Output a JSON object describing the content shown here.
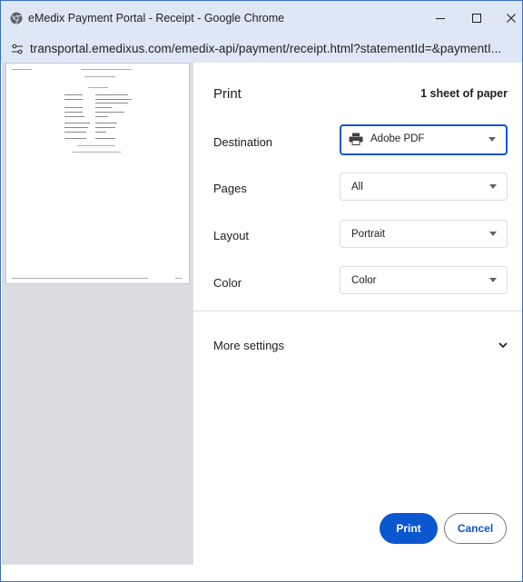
{
  "window": {
    "title": "eMedix Payment Portal - Receipt - Google Chrome",
    "controls": {
      "minimize": "minimize-icon",
      "maximize": "maximize-icon",
      "close": "close-icon"
    }
  },
  "address_bar": {
    "url": "transportal.emedixus.com/emedix-api/payment/receipt.html?statementId=&paymentI..."
  },
  "print_dialog": {
    "title": "Print",
    "sheet_count": "1 sheet of paper",
    "settings": [
      {
        "label": "Destination",
        "value": "Adobe PDF",
        "icon": "printer-icon"
      },
      {
        "label": "Pages",
        "value": "All"
      },
      {
        "label": "Layout",
        "value": "Portrait"
      },
      {
        "label": "Color",
        "value": "Color"
      }
    ],
    "more_settings": "More settings",
    "buttons": {
      "print": "Print",
      "cancel": "Cancel"
    }
  },
  "colors": {
    "accent": "#0b57d0",
    "titlebar": "#dde7f6",
    "preview_bg": "#dadce0"
  }
}
